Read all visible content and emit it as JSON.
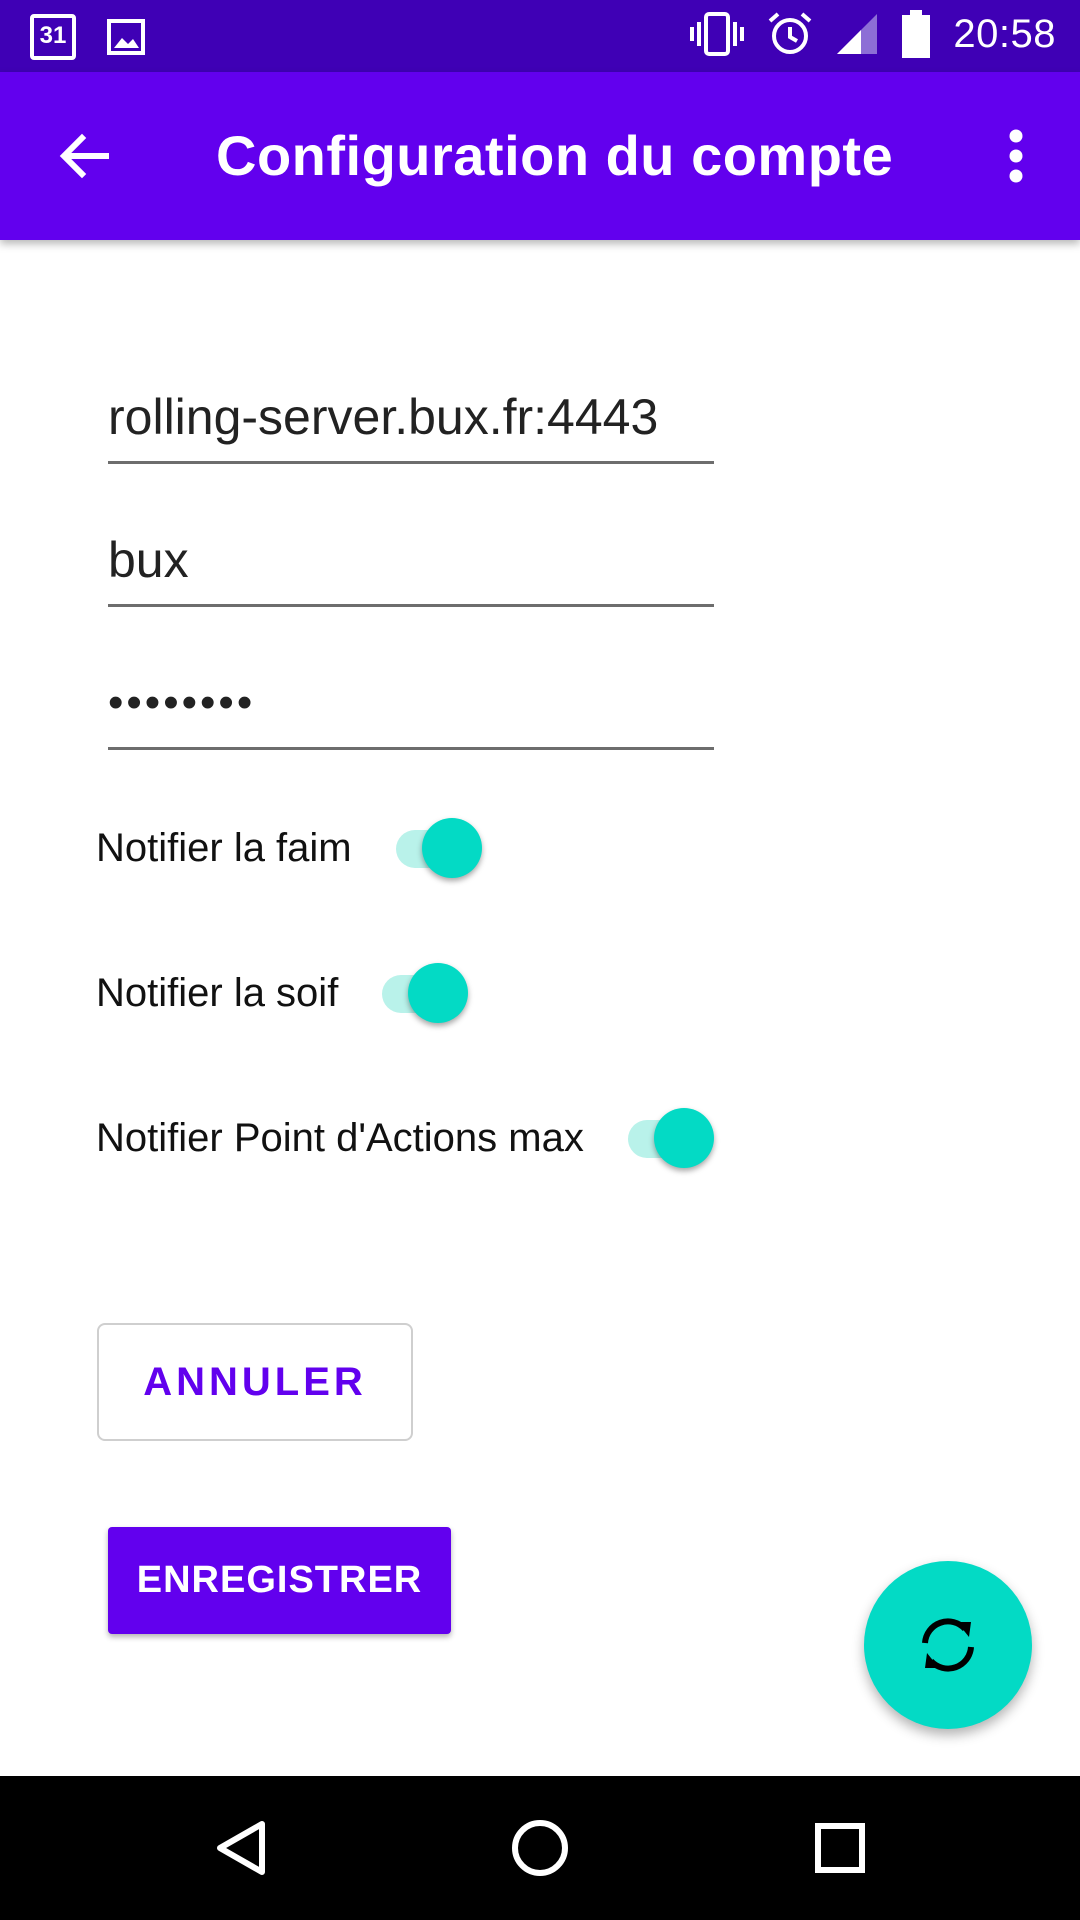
{
  "status_bar": {
    "calendar_day": "31",
    "time": "20:58",
    "icons": [
      "calendar-icon",
      "image-icon",
      "vibrate-icon",
      "alarm-icon",
      "signal-icon",
      "battery-icon"
    ]
  },
  "app_bar": {
    "title": "Configuration du compte",
    "back_icon": "arrow-back-icon",
    "more_icon": "more-vert-icon"
  },
  "form": {
    "server": {
      "value": "rolling-server.bux.fr:4443"
    },
    "username": {
      "value": "bux"
    },
    "password": {
      "value": "12345678"
    }
  },
  "switches": [
    {
      "label": "Notifier la faim",
      "checked": true
    },
    {
      "label": "Notifier la soif",
      "checked": true
    },
    {
      "label": "Notifier Point d'Actions max",
      "checked": true
    }
  ],
  "buttons": {
    "cancel_label": "ANNULER",
    "save_label": "ENREGISTRER"
  },
  "fab": {
    "icon": "sync-icon"
  },
  "nav_bar": {
    "icons": [
      "nav-back-icon",
      "nav-home-icon",
      "nav-recents-icon"
    ]
  },
  "colors": {
    "status_bar": "#3f00b5",
    "primary": "#6200ee",
    "accent": "#03dac5",
    "switch_track": "#b9f2ea"
  }
}
